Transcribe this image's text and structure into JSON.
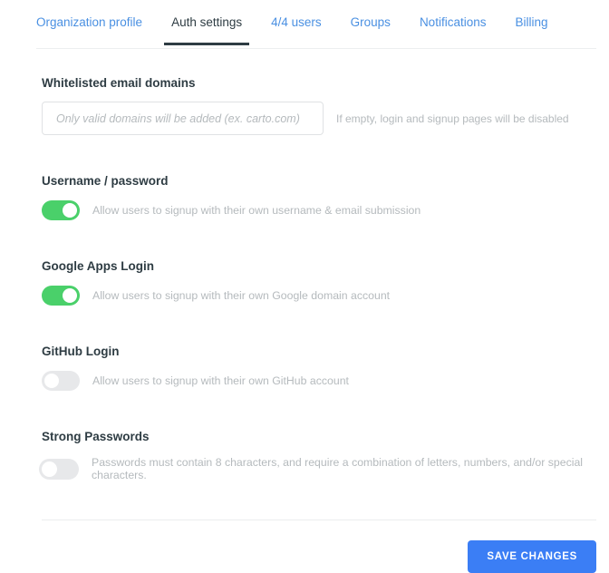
{
  "tabs": [
    {
      "label": "Organization profile",
      "active": false
    },
    {
      "label": "Auth settings",
      "active": true
    },
    {
      "label": "4/4 users",
      "active": false
    },
    {
      "label": "Groups",
      "active": false
    },
    {
      "label": "Notifications",
      "active": false
    },
    {
      "label": "Billing",
      "active": false
    }
  ],
  "whitelist": {
    "label": "Whitelisted email domains",
    "placeholder": "Only valid domains will be added (ex. carto.com)",
    "value": "",
    "hint": "If empty, login and signup pages will be disabled"
  },
  "blocks": [
    {
      "title": "Username / password",
      "description": "Allow users to signup with their own username & email submission",
      "enabled": true
    },
    {
      "title": "Google Apps Login",
      "description": "Allow users to signup with their own Google domain account",
      "enabled": true
    },
    {
      "title": "GitHub Login",
      "description": "Allow users to signup with their own GitHub account",
      "enabled": false
    },
    {
      "title": "Strong Passwords",
      "description": "Passwords must contain 8 characters, and require a combination of letters, numbers, and/or special characters.",
      "enabled": false
    }
  ],
  "footer": {
    "save_label": "SAVE CHANGES"
  },
  "colors": {
    "link": "#4a90e2",
    "active_text": "#2e3c43",
    "toggle_on": "#4ad06a",
    "toggle_off": "#e7e8ea",
    "primary_button": "#3b7ef5",
    "muted_text": "#b5babd"
  }
}
